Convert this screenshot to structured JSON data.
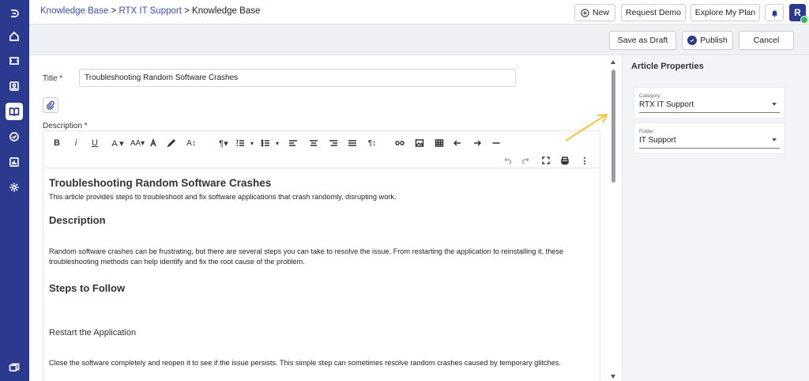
{
  "breadcrumb": {
    "part1": "Knowledge Base",
    "sep1": ">",
    "part2": "RTX IT Support",
    "sep2": ">",
    "current": "Knowledge Base"
  },
  "topbar": {
    "new_label": "New",
    "request_demo_label": "Request Demo",
    "explore_plan_label": "Explore My Plan",
    "avatar_initial": "R"
  },
  "actions": {
    "save_draft_label": "Save as Draft",
    "publish_label": "Publish",
    "cancel_label": "Cancel"
  },
  "form": {
    "title_label": "Title *",
    "title_value": "Troubleshooting Random Software Crashes",
    "description_label": "Description *"
  },
  "toolbar": {
    "items": [
      "bold-icon",
      "italic-icon",
      "underline-icon",
      "font-color-icon",
      "font-size-icon",
      "format-painter-icon",
      "highlight-icon",
      "text-size-icon",
      "paragraph-icon",
      "ordered-list-icon",
      "unordered-list-icon",
      "align-left-icon",
      "align-center-icon",
      "align-right-icon",
      "justify-icon",
      "direction-icon",
      "link-icon",
      "image-icon",
      "table-icon",
      "undo-arrow-icon",
      "redo-arrow-icon",
      "horizontal-rule-icon",
      "undo-icon",
      "redo-icon",
      "fullscreen-icon",
      "print-icon",
      "more-icon"
    ]
  },
  "article": {
    "heading": "Troubleshooting Random Software Crashes",
    "intro": "This article provides steps to troubleshoot and fix software applications that crash randomly, disrupting work.",
    "desc_heading": "Description",
    "desc_text": "Random software crashes can be frustrating, but there are several steps you can take to resolve the issue. From restarting the application to reinstalling it, these troubleshooting methods can help identify and fix the root cause of the problem.",
    "steps_heading": "Steps to Follow",
    "step1_title": "Restart the Application",
    "step1_text": "Close the software completely and reopen it to see if the issue persists. This simple step can sometimes resolve random crashes caused by temporary glitches."
  },
  "panel": {
    "title": "Article Properties",
    "category_label": "Category:",
    "category_value": "RTX IT Support",
    "folder_label": "Folder:",
    "folder_value": "IT Support"
  },
  "colors": {
    "sidebar": "#2b3a8f",
    "accent": "#3b4fb0",
    "annotation_arrow": "#f3c43a",
    "online": "#2eb85c"
  }
}
